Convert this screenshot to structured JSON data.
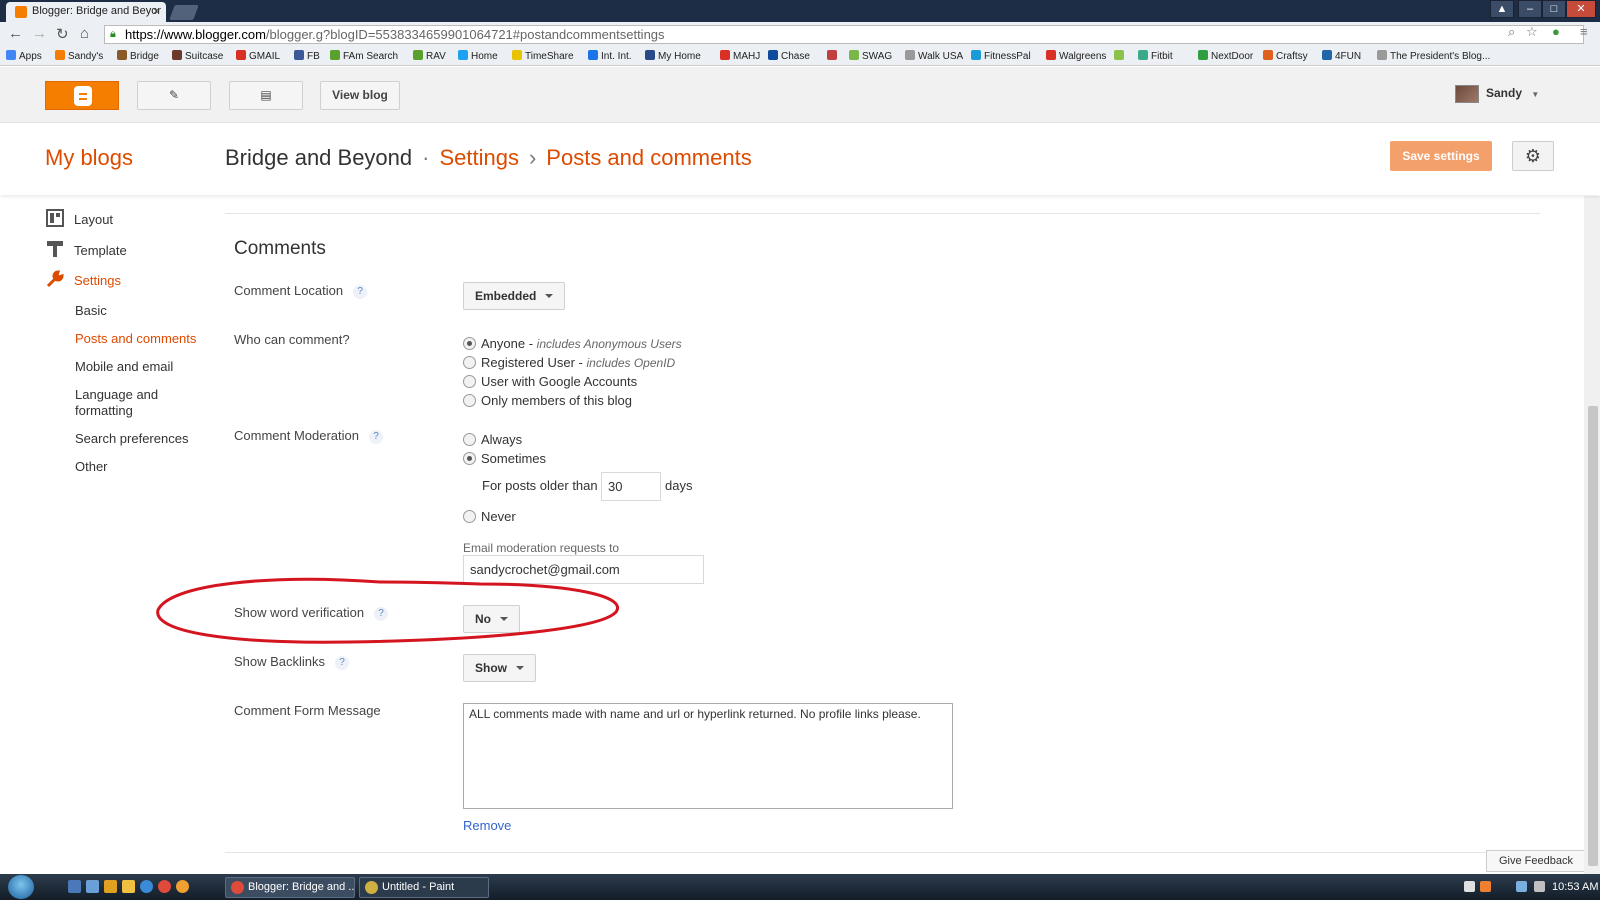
{
  "browser": {
    "tab_title": "Blogger: Bridge and Beyor",
    "tab_close": "×",
    "url_host": "https://www.blogger.com",
    "url_rest": "/blogger.g?blogID=5538334659901064721#postandcommentsettings",
    "bookmarks": [
      "Apps",
      "Sandy's",
      "Bridge",
      "Suitcase",
      "GMAIL",
      "FB",
      "FAm Search",
      "RAV",
      "Home",
      "TimeShare",
      "Int. Int.",
      "My Home",
      "MAHJ",
      "Chase",
      "",
      "SWAG",
      "Walk USA",
      "FitnessPal",
      "Walgreens",
      "",
      "Fitbit",
      "NextDoor",
      "Craftsy",
      "4FUN",
      "The President's Blog..."
    ]
  },
  "toolbar": {
    "view_blog": "View blog",
    "user_name": "Sandy"
  },
  "header": {
    "my_blogs": "My blogs",
    "blog_name": "Bridge and Beyond",
    "dot": "·",
    "crumb_settings": "Settings",
    "arrow": "›",
    "crumb_page": "Posts and comments",
    "save_button": "Save settings"
  },
  "sidebar": {
    "layout": "Layout",
    "template": "Template",
    "settings": "Settings",
    "sub_items": [
      "Basic",
      "Posts and comments",
      "Mobile and email",
      "Language and formatting",
      "Search preferences",
      "Other"
    ]
  },
  "comments": {
    "section_title": "Comments",
    "location_label": "Comment Location",
    "location_value": "Embedded",
    "who_label": "Who can comment?",
    "who_options": [
      {
        "label": "Anyone - ",
        "note": "includes Anonymous Users",
        "selected": true
      },
      {
        "label": "Registered User - ",
        "note": "includes OpenID",
        "selected": false
      },
      {
        "label": "User with Google Accounts",
        "note": "",
        "selected": false
      },
      {
        "label": "Only members of this blog",
        "note": "",
        "selected": false
      }
    ],
    "moderation_label": "Comment Moderation",
    "moderation_always": "Always",
    "moderation_sometimes": "Sometimes",
    "older_than_label": "For posts older than",
    "older_than_value": "30",
    "days_label": "days",
    "moderation_never": "Never",
    "email_label": "Email moderation requests to",
    "email_value": "sandycrochet@gmail.com",
    "word_verification_label": "Show word verification",
    "word_verification_value": "No",
    "backlinks_label": "Show Backlinks",
    "backlinks_value": "Show",
    "form_message_label": "Comment Form Message",
    "form_message_value": "ALL comments made with name and url or hyperlink returned.  No profile links please.",
    "remove_link": "Remove",
    "help": "?"
  },
  "feedback": "Give Feedback",
  "taskbar": {
    "task1": "Blogger: Bridge and ...",
    "task2": "Untitled - Paint",
    "clock": "10:53 AM"
  },
  "colors": {
    "accent": "#dd4b00",
    "blogger_orange": "#f57d00",
    "save_button": "#f4a06b",
    "annotation_red": "#d4141e"
  }
}
